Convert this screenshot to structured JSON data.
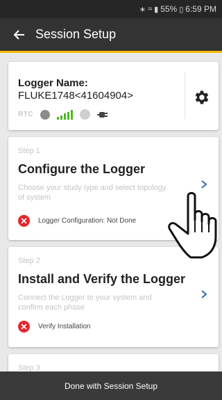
{
  "status_bar": {
    "battery": "55%",
    "time": "6:59 PM",
    "icons": [
      "bluetooth-icon",
      "wifi-icon",
      "signal-icon",
      "battery-icon"
    ]
  },
  "app_bar": {
    "title": "Session Setup",
    "back_icon": "arrow-left-icon"
  },
  "logger": {
    "name_label": "Logger Name:",
    "name_value": "FLUKE1748<41604904>",
    "rtc_label": "RTC",
    "settings_icon": "gear-icon"
  },
  "steps": [
    {
      "label": "Step 1",
      "title": "Configure the Logger",
      "description": "Choose your study type and select topology of system",
      "status": "Logger Configuration: Not Done"
    },
    {
      "label": "Step 2",
      "title": "Install and Verify the Logger",
      "description": "Connect the Logger to your system and confirm each phase",
      "status": "Verify Installation"
    },
    {
      "label": "Step 3"
    }
  ],
  "footer": {
    "done_label": "Done with Session Setup"
  },
  "colors": {
    "app_bar": "#333333",
    "accent_underline": "#f5b800",
    "error": "#e3282d",
    "chevron": "#2a6fb3",
    "signal": "#4db81f"
  }
}
